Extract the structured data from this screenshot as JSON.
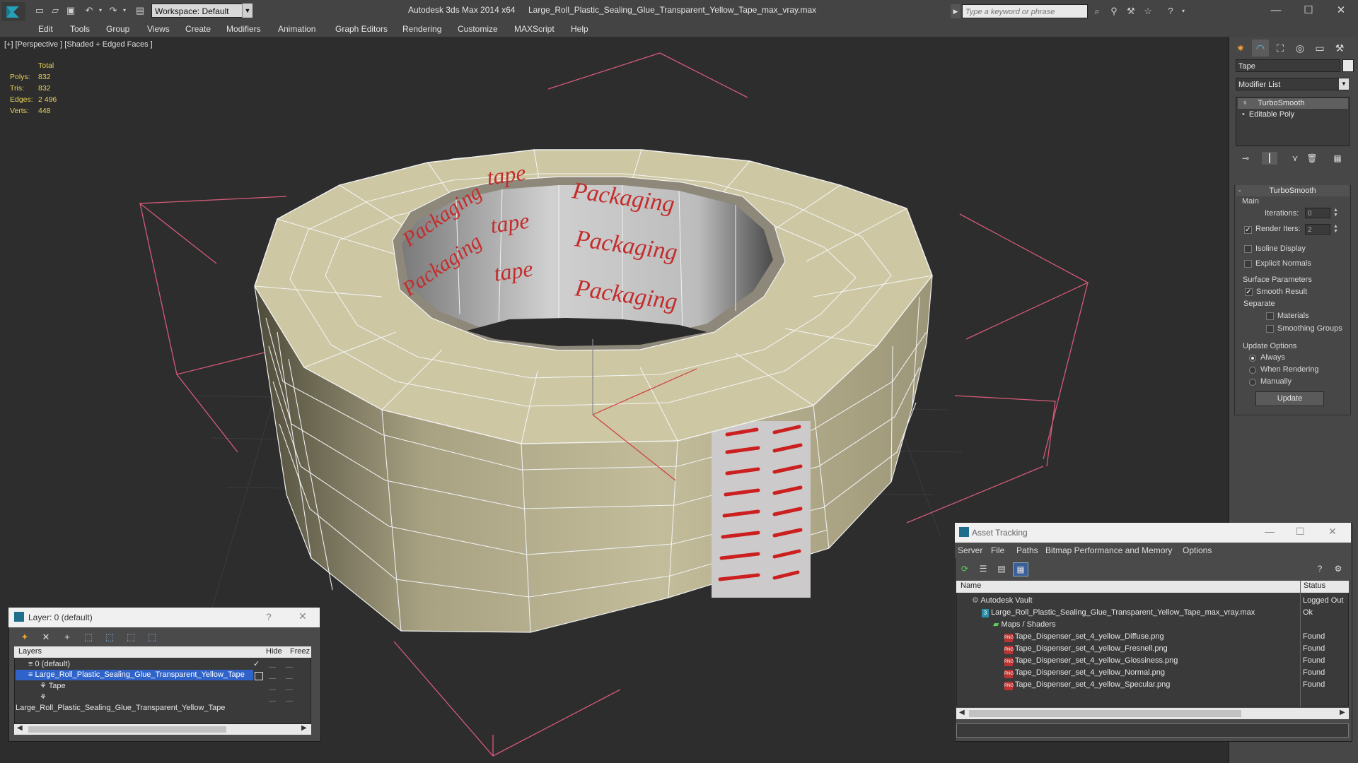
{
  "titlebar": {
    "workspace": "Workspace: Default",
    "app_title": "Autodesk 3ds Max  2014 x64",
    "file_title": "Large_Roll_Plastic_Sealing_Glue_Transparent_Yellow_Tape_max_vray.max",
    "search_placeholder": "Type a keyword or phrase"
  },
  "menu": [
    "Edit",
    "Tools",
    "Group",
    "Views",
    "Create",
    "Modifiers",
    "Animation",
    "Graph Editors",
    "Rendering",
    "Customize",
    "MAXScript",
    "Help"
  ],
  "viewport": {
    "label": "[+] [Perspective ] [Shaded + Edged Faces ]",
    "stats_header": "Total",
    "stats": [
      {
        "key": "Polys:",
        "value": "832"
      },
      {
        "key": "Tris:",
        "value": "832"
      },
      {
        "key": "Edges:",
        "value": "2 496"
      },
      {
        "key": "Verts:",
        "value": "448"
      }
    ],
    "texture_words": [
      "Packaging",
      "tape"
    ]
  },
  "command_panel": {
    "object_name": "Tape",
    "modifier_list": "Modifier List",
    "stack": [
      "TurboSmooth",
      "Editable Poly"
    ],
    "rollout_title": "TurboSmooth",
    "main_group": "Main",
    "iterations_label": "Iterations:",
    "iterations_value": "0",
    "render_iters_label": "Render Iters:",
    "render_iters_value": "2",
    "isoline_display": "Isoline Display",
    "explicit_normals": "Explicit Normals",
    "surface_group": "Surface Parameters",
    "smooth_result": "Smooth Result",
    "separate": "Separate",
    "materials": "Materials",
    "smoothing_groups": "Smoothing Groups",
    "update_group": "Update Options",
    "always": "Always",
    "when_rendering": "When Rendering",
    "manually": "Manually",
    "update_button": "Update"
  },
  "layer_window": {
    "title": "Layer: 0 (default)",
    "col_layers": "Layers",
    "col_hide": "Hide",
    "col_freeze": "Freeze",
    "rows": [
      "0 (default)",
      "Large_Roll_Plastic_Sealing_Glue_Transparent_Yellow_Tape",
      "Tape",
      "Large_Roll_Plastic_Sealing_Glue_Transparent_Yellow_Tape"
    ]
  },
  "asset_tracking": {
    "title": "Asset Tracking",
    "menu": [
      "Server",
      "File",
      "Paths",
      "Bitmap Performance and Memory",
      "Options"
    ],
    "col_name": "Name",
    "col_status": "Status",
    "rows": [
      {
        "name": "Autodesk Vault",
        "status": "Logged Out"
      },
      {
        "name": "Large_Roll_Plastic_Sealing_Glue_Transparent_Yellow_Tape_max_vray.max",
        "status": "Ok"
      },
      {
        "name": "Maps / Shaders",
        "status": ""
      },
      {
        "name": "Tape_Dispenser_set_4_yellow_Diffuse.png",
        "status": "Found"
      },
      {
        "name": "Tape_Dispenser_set_4_yellow_Fresnell.png",
        "status": "Found"
      },
      {
        "name": "Tape_Dispenser_set_4_yellow_Glossiness.png",
        "status": "Found"
      },
      {
        "name": "Tape_Dispenser_set_4_yellow_Normal.png",
        "status": "Found"
      },
      {
        "name": "Tape_Dispenser_set_4_yellow_Specular.png",
        "status": "Found"
      }
    ]
  },
  "colors": {
    "viewport_bg": "#2d2d2d",
    "tape_face": "#cdc7a3",
    "bbox_bracket": "#d45a78",
    "selection": "#2f63c9"
  }
}
